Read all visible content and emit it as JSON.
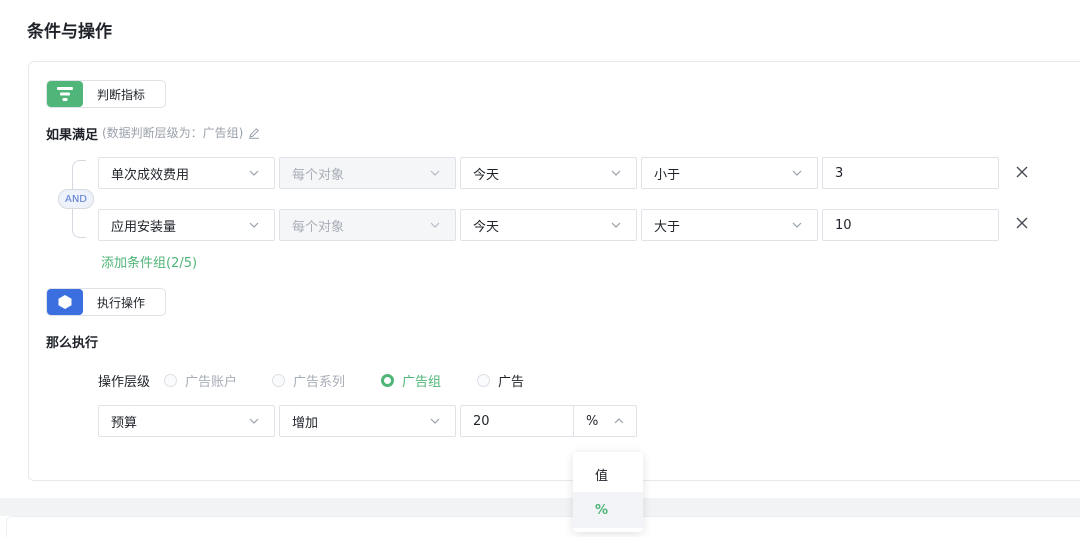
{
  "section_title": "条件与操作",
  "judge_tag": {
    "label": "判断指标",
    "icon": "filter-icon",
    "color": "#4fb578"
  },
  "if_label": "如果满足",
  "if_hint": "(数据判断层级为：广告组)",
  "and_label": "AND",
  "conditions": [
    {
      "metric": "单次成效费用",
      "scope": "每个对象",
      "time": "今天",
      "operator": "小于",
      "value": "3"
    },
    {
      "metric": "应用安装量",
      "scope": "每个对象",
      "time": "今天",
      "operator": "大于",
      "value": "10"
    }
  ],
  "add_condition_label": "添加条件组(2/5)",
  "exec_tag": {
    "label": "执行操作",
    "icon": "layers-icon",
    "color": "#3b6fe0"
  },
  "then_label": "那么执行",
  "level_label": "操作层级",
  "levels": [
    {
      "label": "广告账户",
      "state": "disabled"
    },
    {
      "label": "广告系列",
      "state": "disabled"
    },
    {
      "label": "广告组",
      "state": "checked"
    },
    {
      "label": "广告",
      "state": "normal"
    }
  ],
  "action": {
    "target": "预算",
    "operation": "增加",
    "amount": "20",
    "unit": "%"
  },
  "unit_options": [
    {
      "label": "值",
      "selected": false
    },
    {
      "label": "%",
      "selected": true
    }
  ],
  "colors": {
    "accent_green": "#4fb578",
    "accent_blue": "#3b6fe0",
    "border": "#dfe2e6"
  }
}
